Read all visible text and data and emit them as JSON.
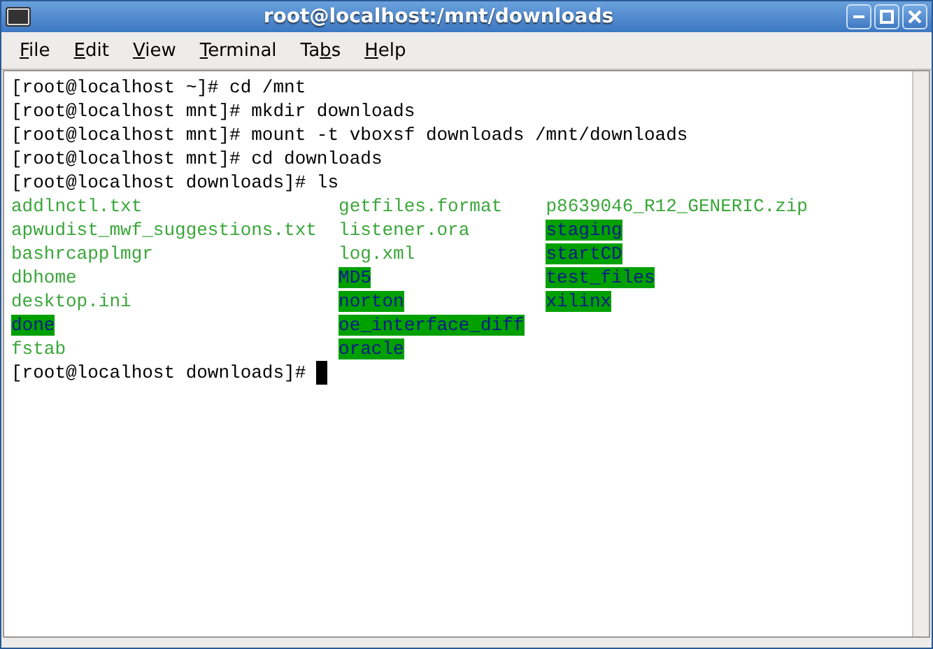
{
  "window": {
    "title": "root@localhost:/mnt/downloads"
  },
  "menu": [
    {
      "key": "F",
      "after": "ile"
    },
    {
      "key": "E",
      "after": "dit"
    },
    {
      "key": "V",
      "after": "iew"
    },
    {
      "key": "T",
      "after": "erminal"
    },
    {
      "before": "Ta",
      "key": "b",
      "after": "s"
    },
    {
      "key": "H",
      "after": "elp"
    }
  ],
  "terminal": {
    "lines": [
      {
        "kind": "text",
        "text": "[root@localhost ~]# cd /mnt"
      },
      {
        "kind": "text",
        "text": "[root@localhost mnt]# mkdir downloads"
      },
      {
        "kind": "text",
        "text": "[root@localhost mnt]# mount -t vboxsf downloads /mnt/downloads"
      },
      {
        "kind": "text",
        "text": "[root@localhost mnt]# cd downloads"
      },
      {
        "kind": "text",
        "text": "[root@localhost downloads]# ls"
      },
      {
        "kind": "listing",
        "cells": [
          {
            "name": "addlnctl.txt",
            "kind": "file"
          },
          {
            "name": "getfiles.format",
            "kind": "file"
          },
          {
            "name": "p8639046_R12_GENERIC.zip",
            "kind": "file"
          }
        ]
      },
      {
        "kind": "listing",
        "cells": [
          {
            "name": "apwudist_mwf_suggestions.txt",
            "kind": "file"
          },
          {
            "name": "listener.ora",
            "kind": "file"
          },
          {
            "name": "staging",
            "kind": "dir"
          }
        ]
      },
      {
        "kind": "listing",
        "cells": [
          {
            "name": "bashrcapplmgr",
            "kind": "file"
          },
          {
            "name": "log.xml",
            "kind": "file"
          },
          {
            "name": "startCD",
            "kind": "dir"
          }
        ]
      },
      {
        "kind": "listing",
        "cells": [
          {
            "name": "dbhome",
            "kind": "file"
          },
          {
            "name": "MD5",
            "kind": "dir"
          },
          {
            "name": "test_files",
            "kind": "dir"
          }
        ]
      },
      {
        "kind": "listing",
        "cells": [
          {
            "name": "desktop.ini",
            "kind": "file"
          },
          {
            "name": "norton",
            "kind": "dir"
          },
          {
            "name": "xilinx",
            "kind": "dir"
          }
        ]
      },
      {
        "kind": "listing",
        "cells": [
          {
            "name": "done",
            "kind": "dir"
          },
          {
            "name": "oe_interface_diff",
            "kind": "dir"
          }
        ]
      },
      {
        "kind": "listing",
        "cells": [
          {
            "name": "fstab",
            "kind": "file"
          },
          {
            "name": "oracle",
            "kind": "dir"
          }
        ]
      },
      {
        "kind": "text",
        "text": "[root@localhost downloads]#",
        "cursor": true
      }
    ]
  }
}
